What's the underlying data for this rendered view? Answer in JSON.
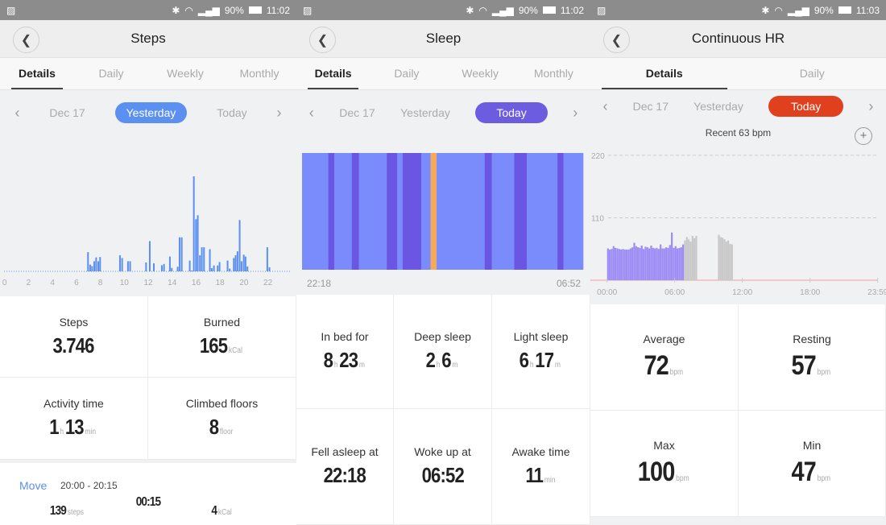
{
  "status_bar": [
    {
      "battery": "90%",
      "time": "11:02"
    },
    {
      "battery": "90%",
      "time": "11:02"
    },
    {
      "battery": "90%",
      "time": "11:03"
    }
  ],
  "colors": {
    "steps_accent": "#5b8ff0",
    "sleep_accent": "#6b5ce0",
    "hr_accent": "#e0401e",
    "light_sleep": "#7a8cfb",
    "deep_sleep": "#6b55e3",
    "awake": "#f7a95a",
    "hr_bar": "#9d8cf5",
    "hr_bar_inactive": "#c8c8c8"
  },
  "steps": {
    "title": "Steps",
    "tabs": [
      "Details",
      "Daily",
      "Weekly",
      "Monthly"
    ],
    "dates": {
      "prev": "Dec 17",
      "selected": "Yesterday",
      "next": "Today"
    },
    "stats": {
      "steps_label": "Steps",
      "steps_value": "3.746",
      "burned_label": "Burned",
      "burned_value": "165",
      "burned_unit": "kCal",
      "activity_label": "Activity time",
      "activity_h": "1",
      "activity_h_unit": "h",
      "activity_m": "13",
      "activity_m_unit": "min",
      "floors_label": "Climbed floors",
      "floors_value": "8",
      "floors_unit": "floor"
    },
    "activity": {
      "type": "Move",
      "range": "20:00 - 20:15",
      "steps": "139",
      "steps_unit": "steps",
      "duration": "00:15",
      "kcal": "4",
      "kcal_unit": "kCal"
    }
  },
  "sleep": {
    "title": "Sleep",
    "tabs": [
      "Details",
      "Daily",
      "Weekly",
      "Monthly"
    ],
    "dates": {
      "prev": "Dec 17",
      "middle": "Yesterday",
      "selected": "Today"
    },
    "start": "22:18",
    "end": "06:52",
    "stats": {
      "inbed_label": "In bed for",
      "inbed_h": "8",
      "inbed_m": "23",
      "deep_label": "Deep sleep",
      "deep_h": "2",
      "deep_m": "6",
      "light_label": "Light sleep",
      "light_h": "6",
      "light_m": "17",
      "h_unit": "h",
      "m_unit": "m",
      "fell_label": "Fell asleep at",
      "fell_value": "22:18",
      "woke_label": "Woke up at",
      "woke_value": "06:52",
      "awake_label": "Awake time",
      "awake_value": "11",
      "awake_unit": "min"
    }
  },
  "hr": {
    "title": "Continuous HR",
    "tabs": [
      "Details",
      "Daily"
    ],
    "dates": {
      "prev": "Dec 17",
      "middle": "Yesterday",
      "selected": "Today"
    },
    "recent": "Recent 63 bpm",
    "stats": {
      "avg_label": "Average",
      "avg_value": "72",
      "resting_label": "Resting",
      "resting_value": "57",
      "max_label": "Max",
      "max_value": "100",
      "min_label": "Min",
      "min_value": "47",
      "unit": "bpm"
    }
  },
  "chart_data": [
    {
      "type": "bar",
      "name_hint": "steps-detail",
      "x_unit": "hour",
      "xticks": [
        "0",
        "2",
        "4",
        "6",
        "8",
        "10",
        "12",
        "14",
        "16",
        "18",
        "20",
        "22"
      ],
      "xlim": [
        0,
        24
      ],
      "points": [
        [
          6.97,
          91
        ],
        [
          7.15,
          32
        ],
        [
          7.31,
          25
        ],
        [
          7.49,
          48
        ],
        [
          7.65,
          66
        ],
        [
          7.83,
          48
        ],
        [
          7.98,
          68
        ],
        [
          9.64,
          76
        ],
        [
          9.82,
          63
        ],
        [
          10.31,
          48
        ],
        [
          10.49,
          48
        ],
        [
          11.82,
          42
        ],
        [
          12.13,
          143
        ],
        [
          12.47,
          38
        ],
        [
          13.14,
          29
        ],
        [
          13.32,
          35
        ],
        [
          13.81,
          70
        ],
        [
          13.97,
          16
        ],
        [
          14.46,
          22
        ],
        [
          14.62,
          161
        ],
        [
          14.8,
          161
        ],
        [
          15.47,
          51
        ],
        [
          15.63,
          4
        ],
        [
          15.81,
          450
        ],
        [
          15.99,
          247
        ],
        [
          16.14,
          266
        ],
        [
          16.32,
          76
        ],
        [
          16.48,
          114
        ],
        [
          16.66,
          114
        ],
        [
          17.15,
          105
        ],
        [
          17.31,
          15
        ],
        [
          17.49,
          28
        ],
        [
          17.8,
          28
        ],
        [
          17.96,
          44
        ],
        [
          18.63,
          51
        ],
        [
          18.81,
          13
        ],
        [
          19.15,
          63
        ],
        [
          19.3,
          76
        ],
        [
          19.46,
          95
        ],
        [
          19.64,
          243
        ],
        [
          19.8,
          48
        ],
        [
          19.98,
          79
        ],
        [
          20.13,
          70
        ],
        [
          20.29,
          23
        ],
        [
          21.95,
          114
        ],
        [
          22.13,
          19
        ]
      ]
    },
    {
      "type": "timeline",
      "name_hint": "sleep-stages",
      "start": "22:18",
      "end": "06:52",
      "segments": [
        [
          "light",
          "22:18",
          "23:06"
        ],
        [
          "deep",
          "23:06",
          "23:17"
        ],
        [
          "light",
          "23:17",
          "23:49"
        ],
        [
          "deep",
          "23:49",
          "00:02"
        ],
        [
          "light",
          "00:02",
          "00:53"
        ],
        [
          "deep",
          "00:53",
          "01:12"
        ],
        [
          "light",
          "01:12",
          "01:22"
        ],
        [
          "deep",
          "01:22",
          "01:56"
        ],
        [
          "light",
          "01:56",
          "02:13"
        ],
        [
          "awake",
          "02:13",
          "02:24"
        ],
        [
          "light",
          "02:24",
          "03:52"
        ],
        [
          "deep",
          "03:52",
          "04:05"
        ],
        [
          "light",
          "04:05",
          "04:46"
        ],
        [
          "deep",
          "04:46",
          "05:09"
        ],
        [
          "light",
          "05:09",
          "06:05"
        ],
        [
          "deep",
          "06:05",
          "06:16"
        ],
        [
          "light",
          "06:16",
          "06:52"
        ]
      ]
    },
    {
      "type": "bar",
      "name_hint": "heart-rate",
      "yticks": [
        110,
        220
      ],
      "ylim": [
        0,
        220
      ],
      "xticks": [
        "00:00",
        "06:00",
        "12:00",
        "18:00",
        "23:59"
      ],
      "active": [
        56,
        54,
        55,
        60,
        57,
        56,
        55,
        54,
        55,
        54,
        54,
        54,
        56,
        58,
        66,
        60,
        58,
        57,
        61,
        55,
        59,
        58,
        56,
        61,
        57,
        56,
        57,
        55,
        63,
        56,
        56,
        58,
        57,
        62,
        84,
        57,
        60,
        56,
        57,
        58,
        63
      ],
      "active_start": "00:00",
      "interval_min": 10,
      "inactive": [
        [
          "06:50",
          [
            70,
            76,
            72,
            68,
            78,
            74,
            78
          ]
        ],
        [
          "09:50",
          [
            80,
            76,
            75,
            72,
            68,
            70,
            64,
            63
          ]
        ]
      ]
    }
  ]
}
